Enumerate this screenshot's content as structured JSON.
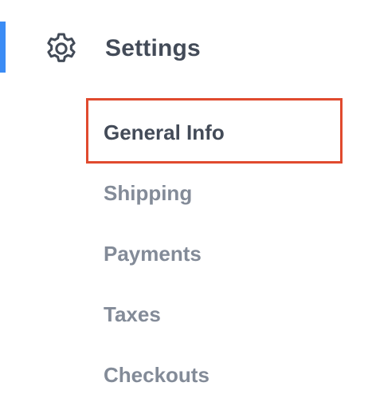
{
  "sidebar": {
    "section": {
      "title": "Settings",
      "icon": "gear-icon"
    },
    "items": [
      {
        "label": "General Info",
        "selected": true
      },
      {
        "label": "Shipping",
        "selected": false
      },
      {
        "label": "Payments",
        "selected": false
      },
      {
        "label": "Taxes",
        "selected": false
      },
      {
        "label": "Checkouts",
        "selected": false
      }
    ]
  },
  "colors": {
    "active_indicator": "#3b8cf5",
    "highlight_border": "#e04a2e",
    "text_dark": "#434b58",
    "text_muted": "#838b98"
  }
}
